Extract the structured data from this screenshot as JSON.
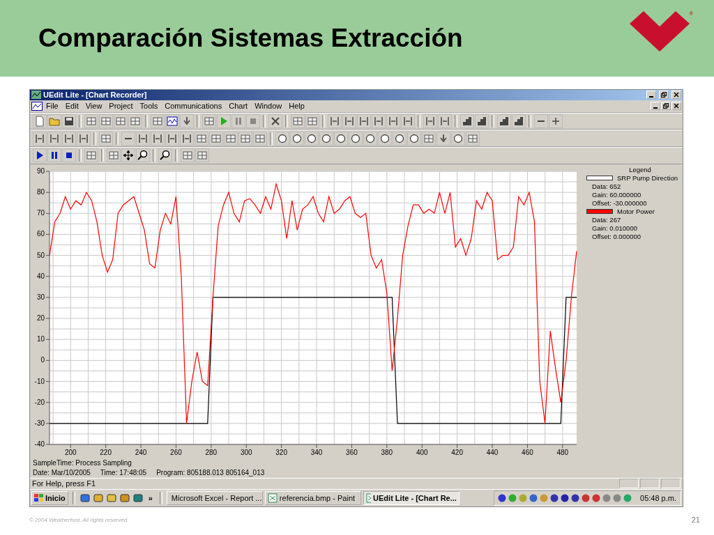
{
  "slide": {
    "title": "Comparación Sistemas Extracción",
    "logo_mark": "®",
    "footer": "© 2004 Weatherford. All rights reserved.",
    "page_number": "21"
  },
  "window": {
    "title": "UEdit Lite - [Chart Recorder]"
  },
  "menu": [
    "File",
    "Edit",
    "View",
    "Project",
    "Tools",
    "Communications",
    "Chart",
    "Window",
    "Help"
  ],
  "chart": {
    "legend_title": "Legend",
    "legend": [
      {
        "color": "#ffffff",
        "data": "Data: 652",
        "gain": "Gain: 60.000000",
        "offset": "Offset: -30.000000"
      },
      {
        "color": "#ff0000",
        "data": "Data: 267",
        "gain": "Gain: 0.010000",
        "offset": "Offset: 0.000000"
      }
    ],
    "sample_time": "SampleTime: Process Sampling",
    "date": "Date: Mar/10/2005",
    "time": "Time: 17:48:05",
    "program": "Program: 805188.013 805164_013",
    "chart_data": {
      "type": "line",
      "grid": true,
      "xlim": [
        188,
        488
      ],
      "ylim": [
        -40,
        90
      ],
      "xticks": [
        200,
        220,
        240,
        260,
        280,
        300,
        320,
        340,
        360,
        380,
        400,
        420,
        440,
        460,
        480
      ],
      "yticks": [
        -40,
        -30,
        -20,
        -10,
        0,
        10,
        20,
        30,
        40,
        50,
        60,
        70,
        80,
        90
      ],
      "x": [
        188,
        191,
        194,
        197,
        200,
        203,
        206,
        209,
        212,
        215,
        218,
        221,
        224,
        227,
        230,
        233,
        236,
        239,
        242,
        245,
        248,
        251,
        254,
        257,
        260,
        263,
        266,
        269,
        272,
        275,
        278,
        281,
        284,
        287,
        290,
        293,
        296,
        299,
        302,
        305,
        308,
        311,
        314,
        317,
        320,
        323,
        326,
        329,
        332,
        335,
        338,
        341,
        344,
        347,
        350,
        353,
        356,
        359,
        362,
        365,
        368,
        371,
        374,
        377,
        380,
        383,
        386,
        389,
        392,
        395,
        398,
        401,
        404,
        407,
        410,
        413,
        416,
        419,
        422,
        425,
        428,
        431,
        434,
        437,
        440,
        443,
        446,
        449,
        452,
        455,
        458,
        461,
        464,
        467,
        470,
        473,
        476,
        479,
        482,
        485,
        488
      ],
      "series": [
        {
          "name": "SRP Pump Direction",
          "color": "#000000",
          "values": [
            -30,
            -30,
            -30,
            -30,
            -30,
            -30,
            -30,
            -30,
            -30,
            -30,
            -30,
            -30,
            -30,
            -30,
            -30,
            -30,
            -30,
            -30,
            -30,
            -30,
            -30,
            -30,
            -30,
            -30,
            -30,
            -30,
            -30,
            -30,
            -30,
            -30,
            -30,
            30,
            30,
            30,
            30,
            30,
            30,
            30,
            30,
            30,
            30,
            30,
            30,
            30,
            30,
            30,
            30,
            30,
            30,
            30,
            30,
            30,
            30,
            30,
            30,
            30,
            30,
            30,
            30,
            30,
            30,
            30,
            30,
            30,
            30,
            30,
            -30,
            -30,
            -30,
            -30,
            -30,
            -30,
            -30,
            -30,
            -30,
            -30,
            -30,
            -30,
            -30,
            -30,
            -30,
            -30,
            -30,
            -30,
            -30,
            -30,
            -30,
            -30,
            -30,
            -30,
            -30,
            -30,
            -30,
            -30,
            -30,
            -30,
            -30,
            -30,
            30,
            30,
            30
          ]
        },
        {
          "name": "Motor Power",
          "color": "#ff0000",
          "values": [
            50,
            66,
            70,
            78,
            72,
            76,
            74,
            80,
            76,
            66,
            50,
            42,
            48,
            70,
            74,
            76,
            78,
            70,
            62,
            46,
            44,
            62,
            70,
            65,
            78,
            40,
            -30,
            -10,
            4,
            -10,
            -12,
            30,
            64,
            74,
            80,
            70,
            66,
            76,
            77,
            74,
            70,
            78,
            72,
            84,
            76,
            58,
            76,
            62,
            72,
            74,
            78,
            70,
            66,
            78,
            70,
            72,
            76,
            78,
            70,
            68,
            70,
            50,
            44,
            48,
            32,
            -5,
            20,
            50,
            64,
            74,
            74,
            70,
            72,
            70,
            80,
            70,
            80,
            54,
            58,
            50,
            58,
            76,
            72,
            80,
            76,
            48,
            50,
            50,
            54,
            78,
            74,
            80,
            66,
            -10,
            -30,
            14,
            -4,
            -20,
            0,
            30,
            52
          ]
        }
      ]
    }
  },
  "status_bar": {
    "text": "For Help, press F1"
  },
  "taskbar": {
    "start": "Inicio",
    "more": "»",
    "tasks": [
      {
        "label": "Microsoft Excel - Report ...",
        "selected": false
      },
      {
        "label": "referencia.bmp - Paint",
        "selected": false
      },
      {
        "label": "UEdit Lite - [Chart Re...",
        "selected": true
      }
    ],
    "clock": "05:48 p.m."
  }
}
